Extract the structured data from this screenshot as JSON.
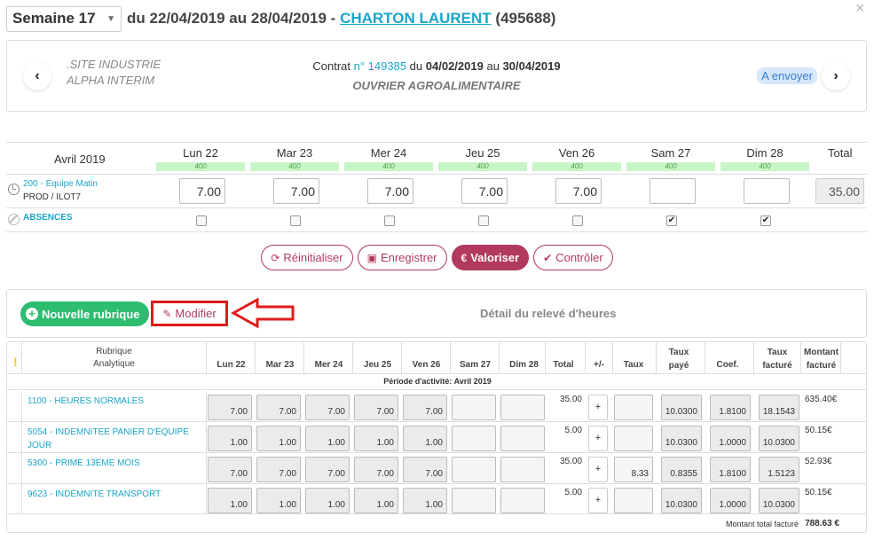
{
  "header": {
    "week_label": "Semaine 17",
    "date_range": "du 22/04/2019 au 28/04/2019 -",
    "person_name": "CHARTON LAURENT",
    "person_id": "(495688)"
  },
  "contract": {
    "site_line1": ".SITE INDUSTRIE",
    "site_line2": "ALPHA INTERIM",
    "contract_prefix": "Contrat",
    "contract_number": "n° 149385",
    "from_word": "du",
    "start_date": "04/02/2019",
    "to_word": "au",
    "end_date": "30/04/2019",
    "job_title": "OUVRIER AGROALIMENTAIRE",
    "status": "A envoyer"
  },
  "week_grid": {
    "month": "Avril 2019",
    "total_label": "Total",
    "days": [
      {
        "name": "Lun 22",
        "code": "400",
        "hours": "7.00",
        "absent": false
      },
      {
        "name": "Mar 23",
        "code": "400",
        "hours": "7.00",
        "absent": false
      },
      {
        "name": "Mer 24",
        "code": "400",
        "hours": "7.00",
        "absent": false
      },
      {
        "name": "Jeu 25",
        "code": "400",
        "hours": "7.00",
        "absent": false
      },
      {
        "name": "Ven 26",
        "code": "400",
        "hours": "7.00",
        "absent": false
      },
      {
        "name": "Sam 27",
        "code": "400",
        "hours": "",
        "absent": true
      },
      {
        "name": "Dim 28",
        "code": "400",
        "hours": "",
        "absent": true
      }
    ],
    "shift_name": "200 - Equipe Matin",
    "shift_sub": "PROD / ILOT7",
    "total_hours": "35.00",
    "absences_label": "ABSENCES"
  },
  "actions": {
    "reset": "Réinitialiser",
    "save": "Enregistrer",
    "valorize": "Valoriser",
    "control": "Contrôler"
  },
  "detail": {
    "new_rubrique": "Nouvelle rubrique",
    "modify": "Modifier",
    "title": "Détail du relevé d'heures"
  },
  "table": {
    "headers": {
      "rubrique": "Rubrique",
      "analytique": "Analytique",
      "days": [
        "Lun 22",
        "Mar 23",
        "Mer 24",
        "Jeu 25",
        "Ven 26",
        "Sam 27",
        "Dim 28"
      ],
      "total": "Total",
      "plusminus": "+/-",
      "taux": "Taux",
      "taux_paye_1": "Taux",
      "taux_paye_2": "payé",
      "coef": "Coef.",
      "taux_facture_1": "Taux",
      "taux_facture_2": "facturé",
      "montant_1": "Montant",
      "montant_2": "facturé"
    },
    "period": "Période d'activité: Avril 2019",
    "rows": [
      {
        "name": "1100 - HEURES NORMALES",
        "days": [
          "7.00",
          "7.00",
          "7.00",
          "7.00",
          "7.00",
          "",
          ""
        ],
        "total": "35.00",
        "pm": "+",
        "taux": "",
        "taux_paye": "10.0300",
        "coef": "1.8100",
        "taux_facture": "18.1543",
        "montant": "635.40€"
      },
      {
        "name": "5054 - INDEMNITEE PANIER D'EQUIPE JOUR",
        "days": [
          "1.00",
          "1.00",
          "1.00",
          "1.00",
          "1.00",
          "",
          ""
        ],
        "total": "5.00",
        "pm": "+",
        "taux": "",
        "taux_paye": "10.0300",
        "coef": "1.0000",
        "taux_facture": "10.0300",
        "montant": "50.15€"
      },
      {
        "name": "5300 - PRIME 13EME MOIS",
        "days": [
          "7.00",
          "7.00",
          "7.00",
          "7.00",
          "7.00",
          "",
          ""
        ],
        "total": "35.00",
        "pm": "+",
        "taux": "8.33",
        "taux_paye": "0.8355",
        "coef": "1.8100",
        "taux_facture": "1.5123",
        "montant": "52.93€"
      },
      {
        "name": "9623 - INDEMNITE TRANSPORT",
        "days": [
          "1.00",
          "1.00",
          "1.00",
          "1.00",
          "1.00",
          "",
          ""
        ],
        "total": "5.00",
        "pm": "+",
        "taux": "",
        "taux_paye": "10.0300",
        "coef": "1.0000",
        "taux_facture": "10.0300",
        "montant": "50.15€"
      }
    ],
    "footer_label": "Montant total facturé",
    "footer_total": "788.63 €"
  },
  "colors": {
    "accent": "#1aa5c9",
    "brand": "#b23a5e",
    "success": "#2ebc70",
    "highlight": "#e01b1b"
  },
  "icons": [
    "close-icon",
    "chevron-left-icon",
    "chevron-right-icon",
    "clock-icon",
    "ban-icon",
    "refresh-icon",
    "save-icon",
    "euro-icon",
    "check-icon",
    "plus-circle-icon",
    "pencil-icon",
    "warning-icon",
    "arrow-icon"
  ]
}
